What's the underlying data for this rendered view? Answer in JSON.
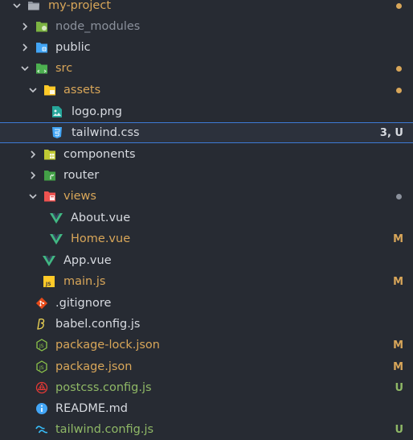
{
  "explorer": {
    "items": [
      {
        "name": "my-project",
        "status": "",
        "dot": true
      },
      {
        "name": "node_modules",
        "status": "",
        "dot": false
      },
      {
        "name": "public",
        "status": "",
        "dot": false
      },
      {
        "name": "src",
        "status": "",
        "dot": true
      },
      {
        "name": "assets",
        "status": "",
        "dot": true
      },
      {
        "name": "logo.png",
        "status": "",
        "dot": false
      },
      {
        "name": "tailwind.css",
        "status": "3, U",
        "dot": false
      },
      {
        "name": "components",
        "status": "",
        "dot": false
      },
      {
        "name": "router",
        "status": "",
        "dot": false
      },
      {
        "name": "views",
        "status": "",
        "dot": true
      },
      {
        "name": "About.vue",
        "status": "",
        "dot": false
      },
      {
        "name": "Home.vue",
        "status": "M",
        "dot": false
      },
      {
        "name": "App.vue",
        "status": "",
        "dot": false
      },
      {
        "name": "main.js",
        "status": "M",
        "dot": false
      },
      {
        "name": ".gitignore",
        "status": "",
        "dot": false
      },
      {
        "name": "babel.config.js",
        "status": "",
        "dot": false
      },
      {
        "name": "package-lock.json",
        "status": "M",
        "dot": false
      },
      {
        "name": "package.json",
        "status": "M",
        "dot": false
      },
      {
        "name": "postcss.config.js",
        "status": "U",
        "dot": false
      },
      {
        "name": "README.md",
        "status": "",
        "dot": false
      },
      {
        "name": "tailwind.config.js",
        "status": "U",
        "dot": false
      }
    ]
  },
  "colors": {
    "background": "#272b33",
    "modified": "#d8a659",
    "untracked": "#8fb866",
    "selected_border": "#3d7ad6"
  }
}
